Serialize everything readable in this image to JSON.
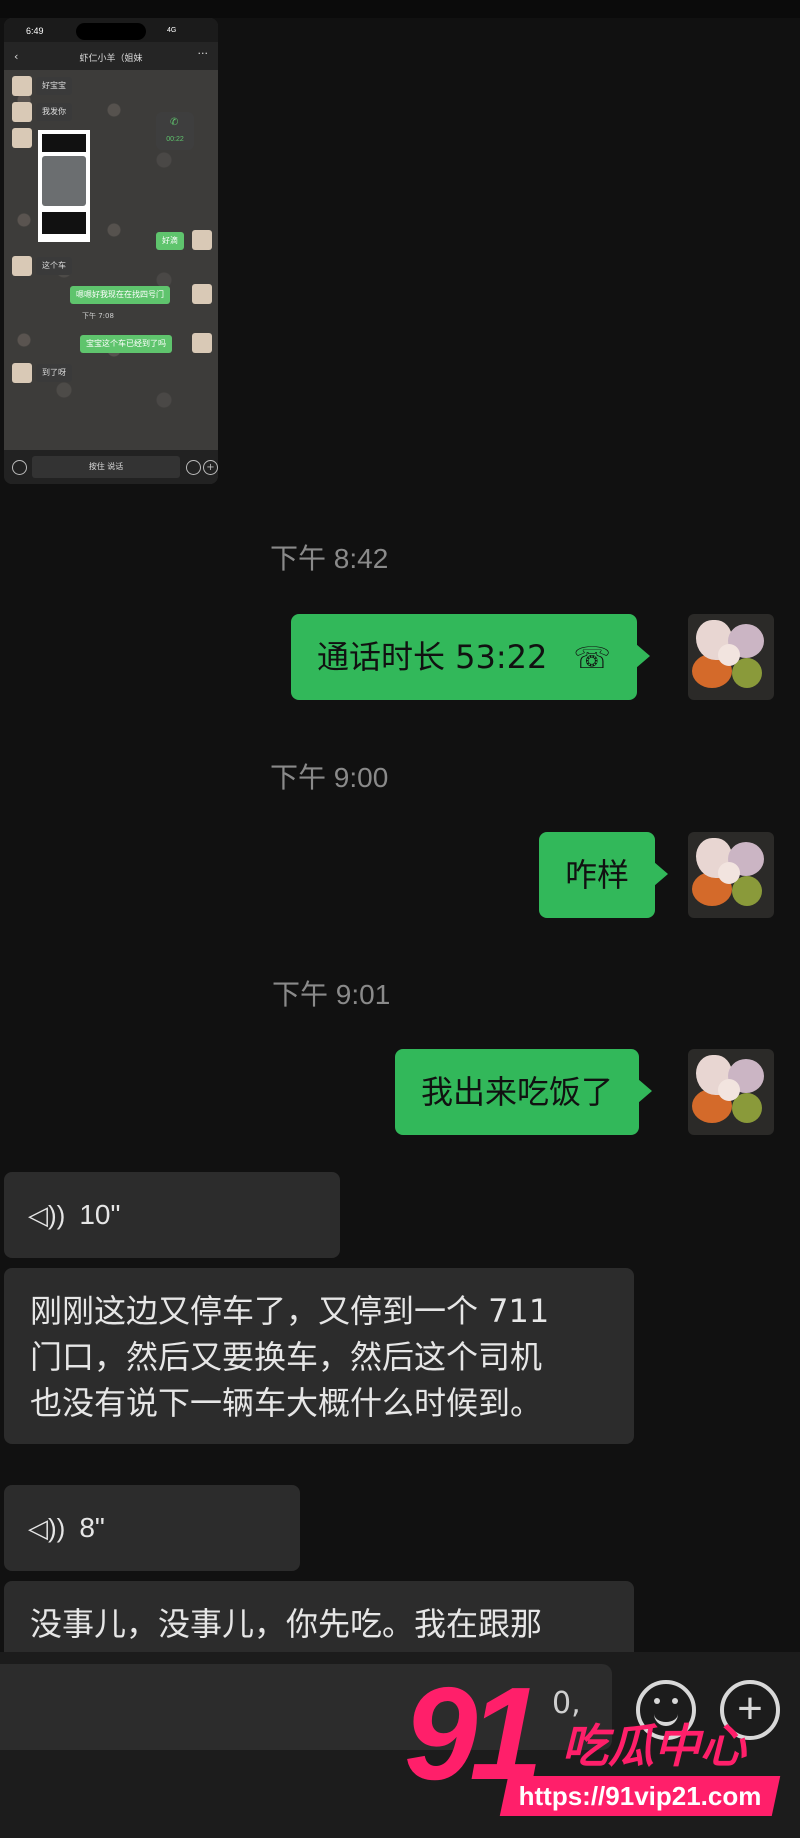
{
  "embedded_screenshot": {
    "status_time": "6:49",
    "status_network": "4G",
    "chat_title": "虾仁小羊（姐妹",
    "call_duration": "00:22",
    "messages": [
      {
        "dir": "in",
        "text": "好宝宝"
      },
      {
        "dir": "in",
        "text": "我发你"
      },
      {
        "dir": "out",
        "text": "好滴"
      },
      {
        "dir": "in",
        "text": "这个车"
      },
      {
        "dir": "out",
        "text": "嗯嗯好我现在在找四号门"
      },
      {
        "dir": "out",
        "text": "宝宝这个车已经到了吗"
      },
      {
        "dir": "in",
        "text": "到了呀"
      }
    ],
    "timestamp": "下午 7:08",
    "hold_to_talk": "按住 说话"
  },
  "chat": {
    "timestamps": [
      "下午 8:42",
      "下午 9:00",
      "下午 9:01"
    ],
    "outgoing": [
      {
        "text": "通话时长 53:22",
        "icon": "phone-hangup-icon"
      },
      {
        "text": "咋样"
      },
      {
        "text": "我出来吃饭了"
      }
    ],
    "incoming": [
      {
        "type": "voice",
        "duration": "10\""
      },
      {
        "type": "text",
        "lines": [
          "刚刚这边又停车了，又停到一个 711",
          "门口，然后又要换车，然后这个司机",
          "也没有说下一辆车大概什么时候到。"
        ]
      },
      {
        "type": "voice",
        "duration": "8\""
      },
      {
        "type": "text",
        "lines": [
          "没事儿，没事儿，你先吃。我在跟那"
        ]
      }
    ]
  },
  "input_bar": {
    "draft_fragment": "0,",
    "emoji_icon": "emoji-icon",
    "plus_icon": "plus-icon"
  },
  "watermark": {
    "number": "91",
    "text": "吃瓜中心",
    "url": "https://91vip21.com",
    "color": "#ff1f6a"
  },
  "colors": {
    "background": "#111111",
    "outgoing_bubble": "#32b85a",
    "incoming_bubble": "#2c2c2c",
    "timestamp": "#8a8a8a"
  }
}
